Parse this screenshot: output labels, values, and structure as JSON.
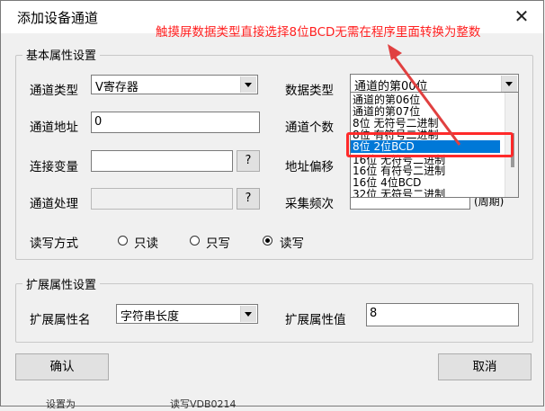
{
  "window": {
    "title": "添加设备通道"
  },
  "annotation": {
    "text": "触摸屏数据类型直接选择8位BCD无需在程序里面转换为整数",
    "color": "#ff2020"
  },
  "basic_group": {
    "legend": "基本属性设置",
    "channel_type": {
      "label": "通道类型",
      "value": "V寄存器"
    },
    "data_type": {
      "label": "数据类型",
      "value": "通道的第00位"
    },
    "channel_address": {
      "label": "通道地址",
      "value": "0"
    },
    "channel_count": {
      "label": "通道个数"
    },
    "connect_variable": {
      "label": "连接变量",
      "value": "",
      "button": "?"
    },
    "address_offset": {
      "label": "地址偏移"
    },
    "channel_process": {
      "label": "通道处理",
      "value": "",
      "button": "?"
    },
    "collect_freq": {
      "label": "采集频次",
      "suffix": "(周期)"
    },
    "rw_mode": {
      "label": "读写方式",
      "options": [
        {
          "label": "只读",
          "selected": false
        },
        {
          "label": "只写",
          "selected": false
        },
        {
          "label": "读写",
          "selected": true
        }
      ]
    }
  },
  "data_type_dropdown": {
    "items": [
      "通道的第06位",
      "通道的第07位",
      "8位 无符号二进制",
      "8位 有符号二进制",
      "8位 2位BCD",
      "16位 无符号二进制",
      "16位 有符号二进制",
      "16位 4位BCD",
      "32位 无符号二进制"
    ],
    "selected_index": 4
  },
  "ext_group": {
    "legend": "扩展属性设置",
    "ext_name": {
      "label": "扩展属性名",
      "value": "字符串长度"
    },
    "ext_value": {
      "label": "扩展属性值",
      "value": "8"
    }
  },
  "buttons": {
    "ok": "确认",
    "cancel": "取消"
  },
  "background_row": {
    "left": "设置为",
    "right": "读写VDB0214"
  },
  "colors": {
    "highlight": "#0078d7",
    "annotation": "#ff2020",
    "arrow": "#e04040"
  }
}
